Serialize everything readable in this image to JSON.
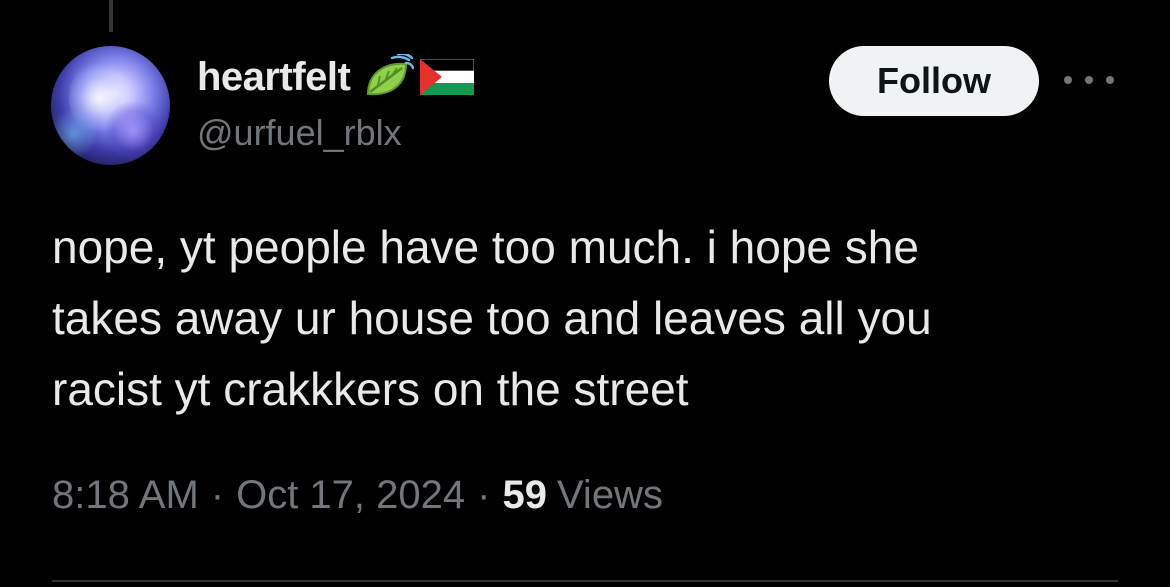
{
  "author": {
    "display_name": "heartfelt",
    "handle": "@urfuel_rblx",
    "badges": [
      "leaf-fluttering-in-wind-emoji",
      "palestine-flag-emoji"
    ]
  },
  "actions": {
    "follow_label": "Follow",
    "more_icon": "more-horizontal-icon"
  },
  "post": {
    "text": "nope, yt people have too much. i hope she\ntakes away ur house too and leaves all you\nracist yt crakkkers on the street"
  },
  "meta": {
    "time": "8:18 AM",
    "separator": "·",
    "date": "Oct 17, 2024",
    "views_count": "59",
    "views_label": "Views"
  },
  "colors": {
    "background": "#000000",
    "primary_text": "#e7e9ea",
    "secondary_text": "#71767b",
    "follow_button_bg": "#eff3f4",
    "follow_button_text": "#0f1419",
    "divider": "#2f3336"
  }
}
